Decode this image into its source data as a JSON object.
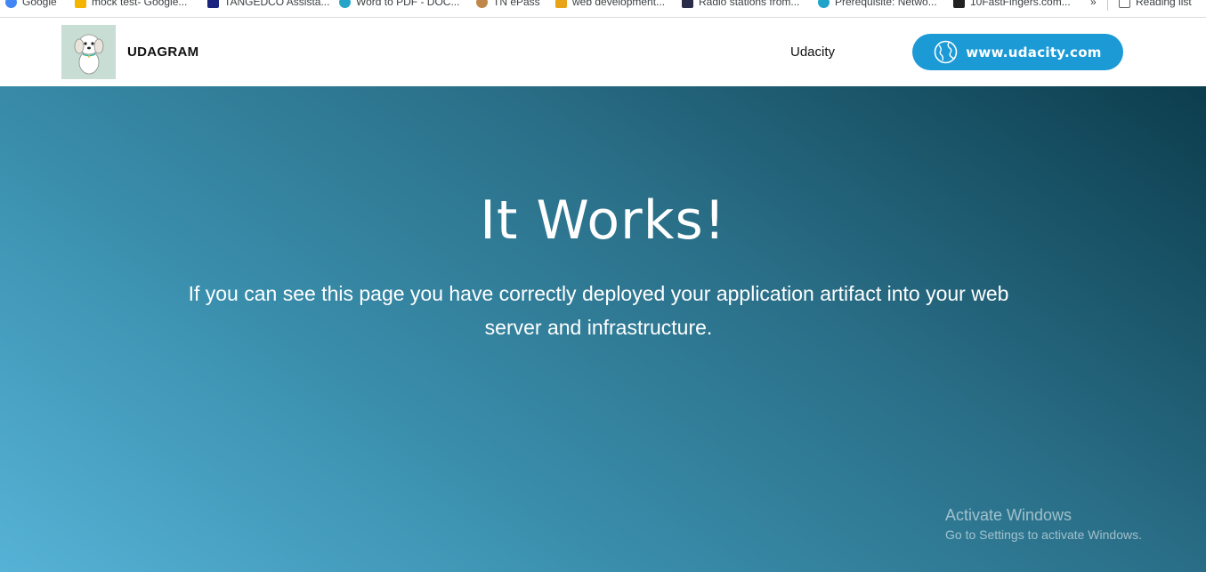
{
  "bookmarks": [
    {
      "label": "Google",
      "icon": "google-icon",
      "color": "#4285f4"
    },
    {
      "label": "mock test- Google...",
      "icon": "drive-icon",
      "color": "#f4b400"
    },
    {
      "label": "TANGEDCO Assista...",
      "icon": "bookmark-flag-icon",
      "color": "#1a237e"
    },
    {
      "label": "Word to PDF - DOC...",
      "icon": "edge-icon",
      "color": "#26a5c9"
    },
    {
      "label": "TN ePass",
      "icon": "emblem-icon",
      "color": "#c0874a"
    },
    {
      "label": "web development...",
      "icon": "pencil-icon",
      "color": "#e8a317"
    },
    {
      "label": "Radio stations from...",
      "icon": "radio-icon",
      "color": "#2b2b4a"
    },
    {
      "label": "Prerequisite: Netwo...",
      "icon": "spiral-icon",
      "color": "#1fa3c9"
    },
    {
      "label": "10FastFingers.com...",
      "icon": "keyboard-icon",
      "color": "#222222"
    }
  ],
  "bookmarks_overflow": "»",
  "reading_list": "Reading list",
  "header": {
    "brand": "UDAGRAM",
    "nav_link": "Udacity",
    "cta_label": "www.udacity.com"
  },
  "hero": {
    "title": "It Works!",
    "text": "If you can see this page you have correctly deployed your application artifact into your web server and infrastructure."
  },
  "watermark": {
    "title": "Activate Windows",
    "subtitle": "Go to Settings to activate Windows."
  },
  "colors": {
    "cta": "#1b9ad6",
    "hero_start": "#56b2d6",
    "hero_end": "#0c3d4d",
    "logo_bg": "#c8ddd3"
  }
}
